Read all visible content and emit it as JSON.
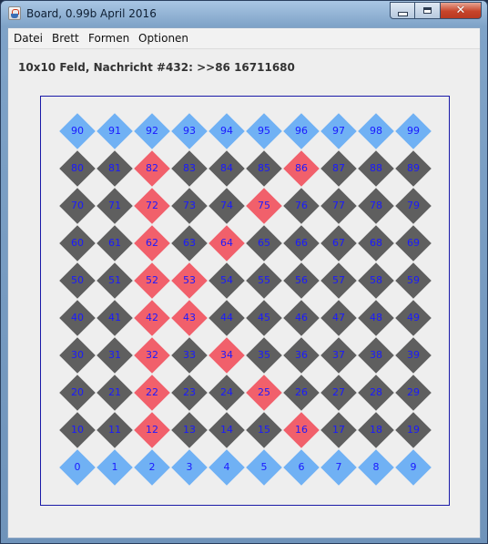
{
  "window": {
    "title": "Board, 0.99b April 2016"
  },
  "menu": [
    "Datei",
    "Brett",
    "Formen",
    "Optionen"
  ],
  "status_line": "10x10 Feld, Nachricht #432: >>86 16711680",
  "board": {
    "rows": 10,
    "cols": 10,
    "colors": {
      "dark": "#5f5f5f",
      "blue": "#70b1f4",
      "red": "#f1606b",
      "number": "#1a1aff",
      "frame": "#1a1aa8"
    },
    "blue_cells": [
      0,
      1,
      2,
      3,
      4,
      5,
      6,
      7,
      8,
      9,
      90,
      91,
      92,
      93,
      94,
      95,
      96,
      97,
      98,
      99
    ],
    "red_cells": [
      12,
      16,
      22,
      25,
      32,
      34,
      42,
      43,
      52,
      53,
      62,
      64,
      72,
      75,
      82,
      86
    ],
    "dark_cells": [
      10,
      11,
      13,
      14,
      15,
      17,
      18,
      19,
      20,
      21,
      23,
      24,
      26,
      27,
      28,
      29,
      30,
      31,
      33,
      35,
      36,
      37,
      38,
      39,
      40,
      41,
      44,
      45,
      46,
      47,
      48,
      49,
      50,
      51,
      54,
      55,
      56,
      57,
      58,
      59,
      60,
      61,
      63,
      65,
      66,
      67,
      68,
      69,
      70,
      71,
      73,
      74,
      76,
      77,
      78,
      79,
      80,
      81,
      83,
      84,
      85,
      87,
      88,
      89
    ]
  }
}
